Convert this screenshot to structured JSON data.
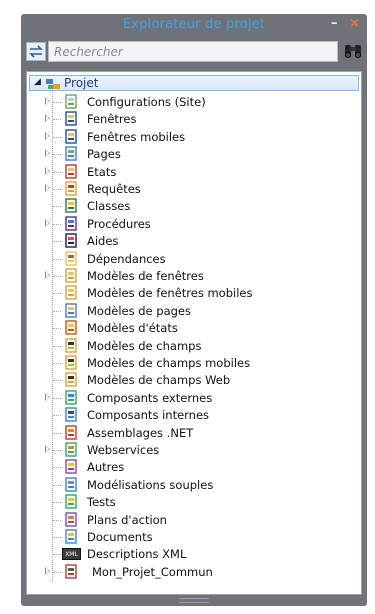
{
  "window": {
    "title": "Explorateur de projet",
    "minimize_glyph": "–",
    "close_glyph": "×"
  },
  "search": {
    "placeholder": "Rechercher",
    "value": ""
  },
  "tree": {
    "root_label": "Projet",
    "items": [
      {
        "label": "Configurations (Site)",
        "icon": "configurations-icon",
        "expandable": true
      },
      {
        "label": "Fenêtres",
        "icon": "window-icon",
        "expandable": true
      },
      {
        "label": "Fenêtres mobiles",
        "icon": "mobile-window-icon",
        "expandable": true
      },
      {
        "label": "Pages",
        "icon": "page-icon",
        "expandable": true
      },
      {
        "label": "Etats",
        "icon": "report-icon",
        "expandable": true
      },
      {
        "label": "Requêtes",
        "icon": "query-icon",
        "expandable": true
      },
      {
        "label": "Classes",
        "icon": "class-icon",
        "expandable": false
      },
      {
        "label": "Procédures",
        "icon": "procedure-icon",
        "expandable": true
      },
      {
        "label": "Aides",
        "icon": "help-icon",
        "expandable": false
      },
      {
        "label": "Dépendances",
        "icon": "dependency-icon",
        "expandable": false
      },
      {
        "label": "Modèles de fenêtres",
        "icon": "window-template-icon",
        "expandable": true
      },
      {
        "label": "Modèles de fenêtres mobiles",
        "icon": "mobile-window-template-icon",
        "expandable": false
      },
      {
        "label": "Modèles de pages",
        "icon": "page-template-icon",
        "expandable": false
      },
      {
        "label": "Modèles d'états",
        "icon": "report-template-icon",
        "expandable": false
      },
      {
        "label": "Modèles de champs",
        "icon": "field-template-icon",
        "expandable": false
      },
      {
        "label": "Modèles de champs mobiles",
        "icon": "mobile-field-template-icon",
        "expandable": false
      },
      {
        "label": "Modèles de champs Web",
        "icon": "web-field-template-icon",
        "expandable": false
      },
      {
        "label": "Composants externes",
        "icon": "external-component-icon",
        "expandable": true
      },
      {
        "label": "Composants internes",
        "icon": "internal-component-icon",
        "expandable": false
      },
      {
        "label": "Assemblages .NET",
        "icon": "dotnet-assembly-icon",
        "expandable": false
      },
      {
        "label": "Webservices",
        "icon": "webservice-icon",
        "expandable": true
      },
      {
        "label": "Autres",
        "icon": "other-icon",
        "expandable": false
      },
      {
        "label": "Modélisations souples",
        "icon": "modeling-icon",
        "expandable": false
      },
      {
        "label": "Tests",
        "icon": "test-icon",
        "expandable": false
      },
      {
        "label": "Plans d'action",
        "icon": "action-plan-icon",
        "expandable": false
      },
      {
        "label": "Documents",
        "icon": "document-icon",
        "expandable": false
      },
      {
        "label": "Descriptions XML",
        "icon": "xml-icon",
        "expandable": false,
        "badge": "XML"
      },
      {
        "label": "Mon_Projet_Commun",
        "icon": "shared-project-icon",
        "expandable": true
      }
    ]
  },
  "colors": {
    "panel_bg": "#6f7379",
    "title_text": "#3fa0e8",
    "root_highlight": "#d6e6f8",
    "root_text": "#2d3a8c"
  }
}
